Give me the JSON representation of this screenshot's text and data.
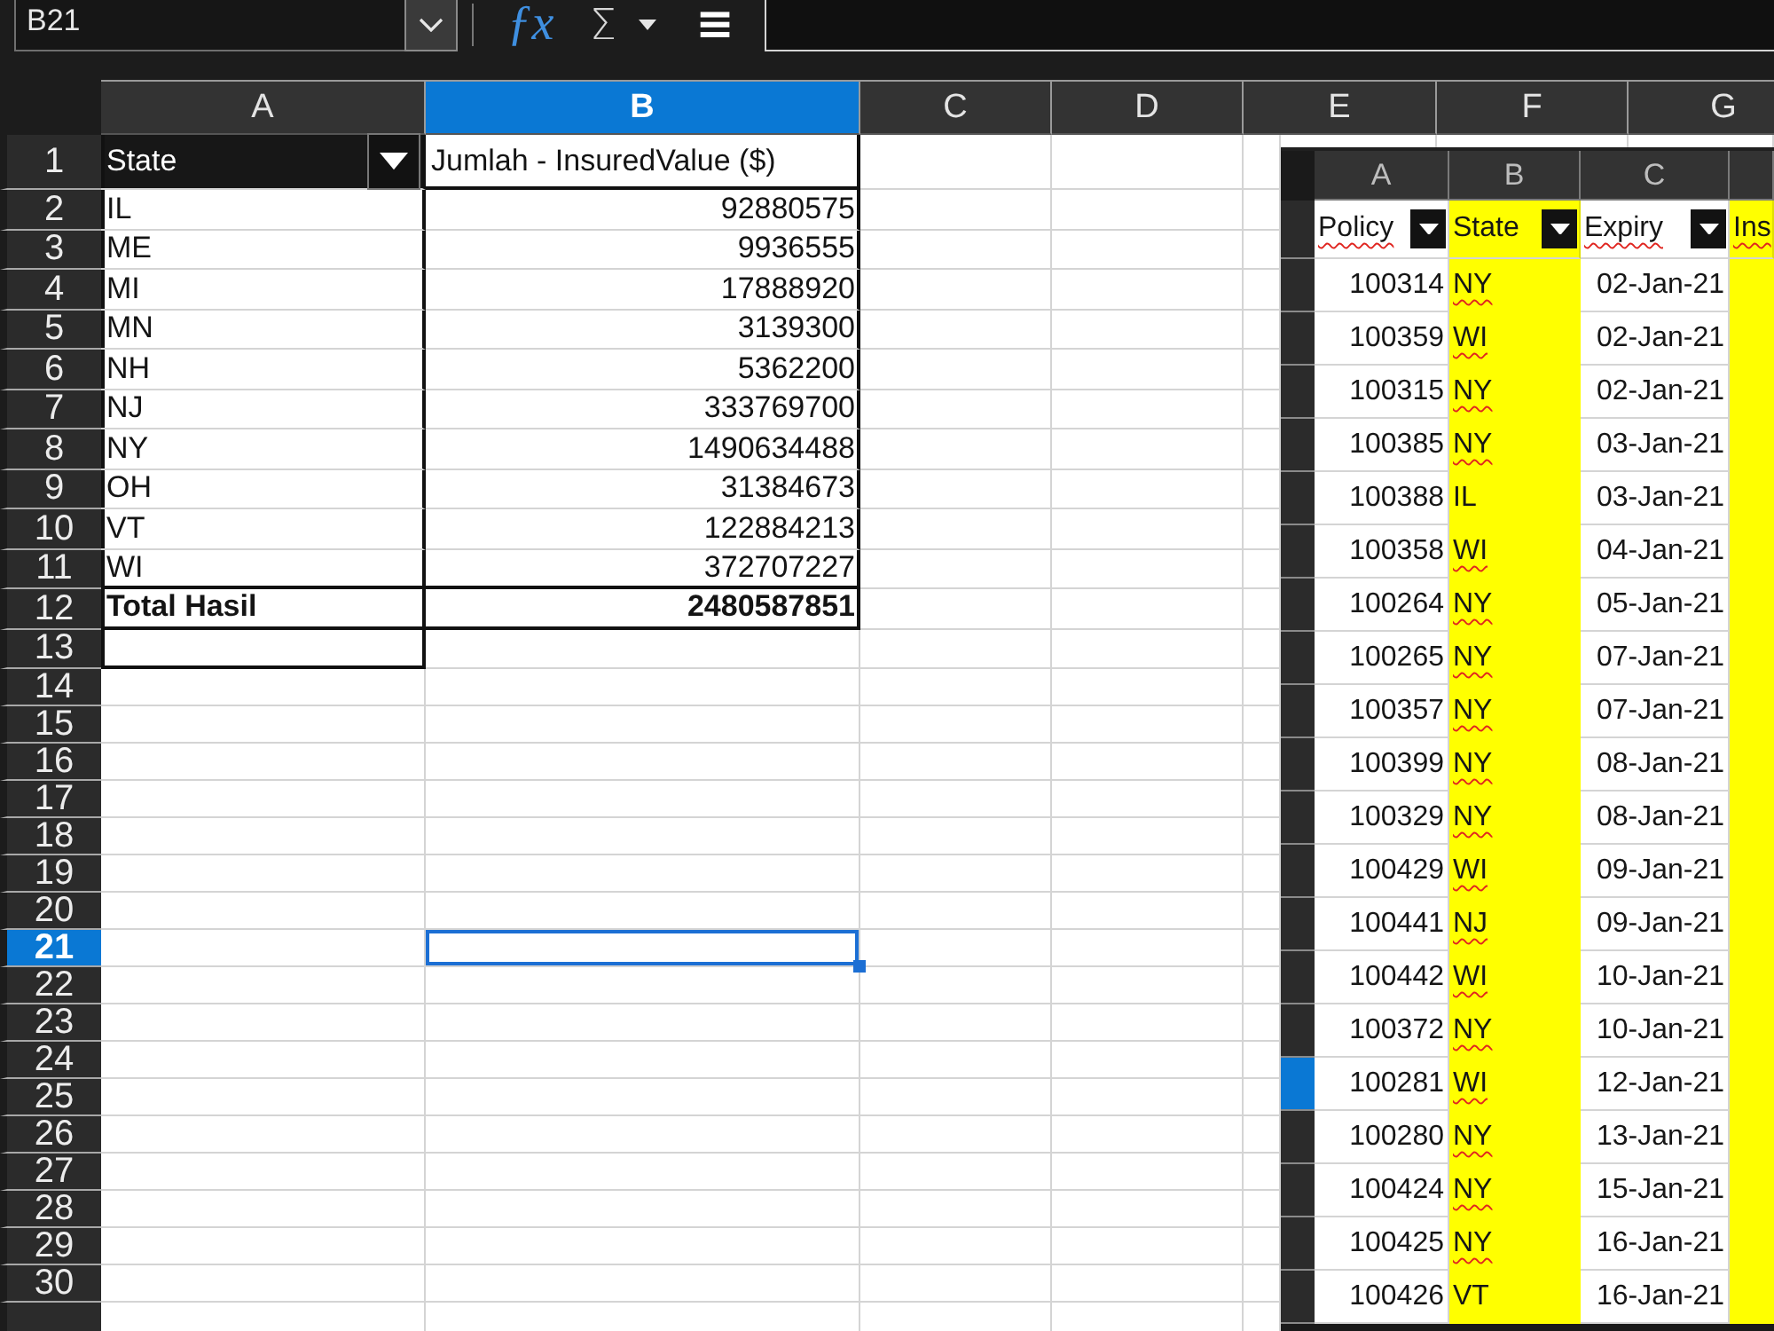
{
  "name_box": {
    "value": "B21"
  },
  "formula_bar": {
    "buttons": [
      {
        "kind": "function",
        "label": "ƒx",
        "menu": false
      },
      {
        "kind": "sum",
        "label": "Σ",
        "menu": true
      },
      {
        "kind": "formula",
        "label": "≡",
        "menu": false
      }
    ]
  },
  "columns": [
    {
      "label": "A",
      "selected": false
    },
    {
      "label": "B",
      "selected": true
    },
    {
      "label": "C",
      "selected": false
    },
    {
      "label": "D",
      "selected": false
    },
    {
      "label": "E",
      "selected": false
    },
    {
      "label": "F",
      "selected": false
    },
    {
      "label": "G",
      "selected": false
    }
  ],
  "rows": [
    {
      "label": "1",
      "selected": false
    },
    {
      "label": "2",
      "selected": false
    },
    {
      "label": "3",
      "selected": false
    },
    {
      "label": "4",
      "selected": false
    },
    {
      "label": "5",
      "selected": false
    },
    {
      "label": "6",
      "selected": false
    },
    {
      "label": "7",
      "selected": false
    },
    {
      "label": "8",
      "selected": false
    },
    {
      "label": "9",
      "selected": false
    },
    {
      "label": "10",
      "selected": false
    },
    {
      "label": "11",
      "selected": false
    },
    {
      "label": "12",
      "selected": false
    },
    {
      "label": "13",
      "selected": false
    },
    {
      "label": "14",
      "selected": false
    },
    {
      "label": "15",
      "selected": false
    },
    {
      "label": "16",
      "selected": false
    },
    {
      "label": "17",
      "selected": false
    },
    {
      "label": "18",
      "selected": false
    },
    {
      "label": "19",
      "selected": false
    },
    {
      "label": "20",
      "selected": false
    },
    {
      "label": "21",
      "selected": true
    },
    {
      "label": "22",
      "selected": false
    },
    {
      "label": "23",
      "selected": false
    },
    {
      "label": "24",
      "selected": false
    },
    {
      "label": "25",
      "selected": false
    },
    {
      "label": "26",
      "selected": false
    },
    {
      "label": "27",
      "selected": false
    },
    {
      "label": "28",
      "selected": false
    },
    {
      "label": "29",
      "selected": false
    },
    {
      "label": "30",
      "selected": false
    }
  ],
  "pivot_table": {
    "headers": [
      {
        "kind": "row_field",
        "label": "State"
      },
      {
        "kind": "data_field",
        "label": "Jumlah - InsuredValue ($)"
      }
    ],
    "rows": [
      {
        "state": "IL",
        "value": "92880575"
      },
      {
        "state": "ME",
        "value": "9936555"
      },
      {
        "state": "MI",
        "value": "17888920"
      },
      {
        "state": "MN",
        "value": "3139300"
      },
      {
        "state": "NH",
        "value": "5362200"
      },
      {
        "state": "NJ",
        "value": "333769700"
      },
      {
        "state": "NY",
        "value": "1490634488"
      },
      {
        "state": "OH",
        "value": "31384673"
      },
      {
        "state": "VT",
        "value": "122884213"
      },
      {
        "state": "WI",
        "value": "372707227"
      }
    ],
    "total": {
      "label": "Total Hasil",
      "value": "2480587851"
    }
  },
  "embedded_sheet": {
    "columns": [
      {
        "label": "A"
      },
      {
        "label": "B"
      },
      {
        "label": "C"
      }
    ],
    "headers": [
      {
        "label": "Policy",
        "highlighted": false,
        "filter": true,
        "misspelled": true
      },
      {
        "label": "State",
        "highlighted": true,
        "filter": true,
        "misspelled": false
      },
      {
        "label": "Expiry",
        "highlighted": false,
        "filter": true,
        "misspelled": true
      },
      {
        "label": "Ins",
        "highlighted": true,
        "filter": false,
        "misspelled": true
      }
    ],
    "rows": [
      {
        "policy": "100314",
        "state": "NY",
        "expiry": "02-Jan-21",
        "misspelled": true,
        "selected": false
      },
      {
        "policy": "100359",
        "state": "WI",
        "expiry": "02-Jan-21",
        "misspelled": true,
        "selected": false
      },
      {
        "policy": "100315",
        "state": "NY",
        "expiry": "02-Jan-21",
        "misspelled": true,
        "selected": false
      },
      {
        "policy": "100385",
        "state": "NY",
        "expiry": "03-Jan-21",
        "misspelled": true,
        "selected": false
      },
      {
        "policy": "100388",
        "state": "IL",
        "expiry": "03-Jan-21",
        "misspelled": false,
        "selected": false
      },
      {
        "policy": "100358",
        "state": "WI",
        "expiry": "04-Jan-21",
        "misspelled": true,
        "selected": false
      },
      {
        "policy": "100264",
        "state": "NY",
        "expiry": "05-Jan-21",
        "misspelled": true,
        "selected": false
      },
      {
        "policy": "100265",
        "state": "NY",
        "expiry": "07-Jan-21",
        "misspelled": true,
        "selected": false
      },
      {
        "policy": "100357",
        "state": "NY",
        "expiry": "07-Jan-21",
        "misspelled": true,
        "selected": false
      },
      {
        "policy": "100399",
        "state": "NY",
        "expiry": "08-Jan-21",
        "misspelled": true,
        "selected": false
      },
      {
        "policy": "100329",
        "state": "NY",
        "expiry": "08-Jan-21",
        "misspelled": true,
        "selected": false
      },
      {
        "policy": "100429",
        "state": "WI",
        "expiry": "09-Jan-21",
        "misspelled": true,
        "selected": false
      },
      {
        "policy": "100441",
        "state": "NJ",
        "expiry": "09-Jan-21",
        "misspelled": true,
        "selected": false
      },
      {
        "policy": "100442",
        "state": "WI",
        "expiry": "10-Jan-21",
        "misspelled": true,
        "selected": false
      },
      {
        "policy": "100372",
        "state": "NY",
        "expiry": "10-Jan-21",
        "misspelled": true,
        "selected": false
      },
      {
        "policy": "100281",
        "state": "WI",
        "expiry": "12-Jan-21",
        "misspelled": true,
        "selected": true
      },
      {
        "policy": "100280",
        "state": "NY",
        "expiry": "13-Jan-21",
        "misspelled": true,
        "selected": false
      },
      {
        "policy": "100424",
        "state": "NY",
        "expiry": "15-Jan-21",
        "misspelled": true,
        "selected": false
      },
      {
        "policy": "100425",
        "state": "NY",
        "expiry": "16-Jan-21",
        "misspelled": true,
        "selected": false
      },
      {
        "policy": "100426",
        "state": "VT",
        "expiry": "16-Jan-21",
        "misspelled": false,
        "selected": false
      }
    ]
  }
}
